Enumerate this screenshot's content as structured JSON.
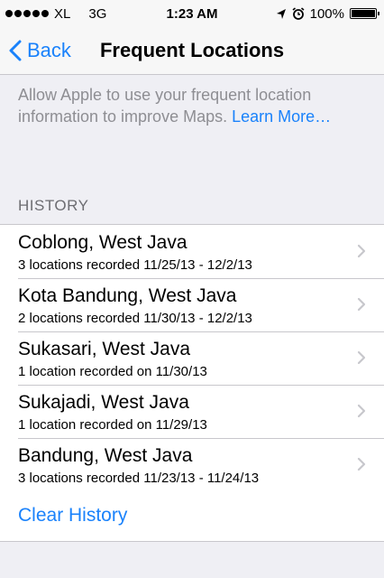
{
  "status_bar": {
    "carrier": "XL",
    "network": "3G",
    "time": "1:23 AM",
    "battery": "100%",
    "battery_level": 1.0
  },
  "nav": {
    "back_label": "Back",
    "title": "Frequent Locations"
  },
  "description": {
    "text": "Allow Apple to use your frequent location information to improve Maps.",
    "link": "Learn More…"
  },
  "history": {
    "header": "HISTORY",
    "items": [
      {
        "title": "Coblong, West Java",
        "subtitle": "3 locations recorded 11/25/13 - 12/2/13"
      },
      {
        "title": "Kota Bandung, West Java",
        "subtitle": "2 locations recorded 11/30/13 - 12/2/13"
      },
      {
        "title": "Sukasari, West Java",
        "subtitle": "1 location recorded on 11/30/13"
      },
      {
        "title": "Sukajadi, West Java",
        "subtitle": "1 location recorded on 11/29/13"
      },
      {
        "title": "Bandung, West Java",
        "subtitle": "3 locations recorded 11/23/13 - 11/24/13"
      }
    ]
  },
  "clear_history_label": "Clear History",
  "colors": {
    "accent": "#1a82fb",
    "background": "#efeff4",
    "secondary_text": "#8e8e93"
  },
  "icons": [
    "signal-dots-icon",
    "location-arrow-icon",
    "alarm-clock-icon",
    "battery-icon",
    "back-chevron-icon",
    "chevron-right-icon"
  ]
}
